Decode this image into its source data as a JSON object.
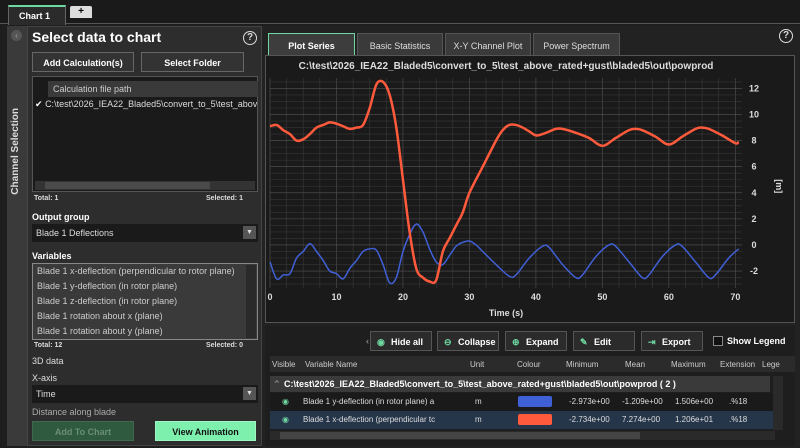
{
  "tabs": {
    "chart1": "Chart 1",
    "add": "+"
  },
  "side_label": "Channel Selection",
  "left": {
    "title": "Select data to chart",
    "add_calc": "Add Calculation(s)",
    "select_folder": "Select Folder",
    "file_header": "Calculation file path",
    "files": [
      "C:\\test\\2026_IEA22_Bladed5\\convert_to_5\\test_above"
    ],
    "files_total": "Total: 1",
    "files_selected": "Selected: 1",
    "output_group_label": "Output group",
    "output_group_value": "Blade 1 Deflections",
    "variables_label": "Variables",
    "variables": [
      "Blade 1 x-deflection (perpendicular to rotor plane)",
      "Blade 1 y-deflection (in rotor plane)",
      "Blade 1 z-deflection (in rotor plane)",
      "Blade 1 rotation about x (plane)",
      "Blade 1 rotation about y (plane)"
    ],
    "vars_total": "Total: 12",
    "vars_selected": "Selected: 0",
    "data3d": "3D data",
    "xaxis_label": "X-axis",
    "xaxis_value": "Time",
    "distance_label": "Distance along blade",
    "add_to_chart": "Add To Chart",
    "view_animation": "View Animation"
  },
  "plot_tabs": [
    "Plot Series",
    "Basic Statistics",
    "X-Y Channel Plot",
    "Power Spectrum"
  ],
  "chart_data": {
    "type": "line",
    "title": "C:\\test\\2026_IEA22_Bladed5\\convert_to_5\\test_above_rated+gust\\bladed5\\out\\powprod",
    "xlabel": "Time (s)",
    "ylabel": "[m]",
    "xlim": [
      0,
      71
    ],
    "ylim": [
      -3.3,
      12.8
    ],
    "xticks": [
      0,
      10,
      20,
      30,
      40,
      50,
      60,
      70
    ],
    "yticks": [
      -2,
      0,
      2,
      4,
      6,
      8,
      10,
      12
    ],
    "grid": true,
    "series": [
      {
        "color": "#ff5a3c",
        "x": [
          0,
          1,
          2,
          3,
          4,
          5,
          6,
          7,
          8,
          9,
          10,
          11,
          12,
          13,
          14,
          15,
          16,
          17,
          18,
          19,
          20,
          21,
          22,
          23,
          24,
          25,
          26,
          27,
          28,
          29,
          30,
          32,
          34,
          35,
          36,
          37,
          38,
          39,
          40,
          41,
          42,
          43,
          44,
          46,
          48,
          50,
          52,
          54,
          55,
          56,
          58,
          60,
          62,
          64,
          65,
          66,
          68,
          70,
          70.5
        ],
        "y": [
          9.1,
          9.2,
          8.8,
          8.5,
          8.0,
          8.1,
          8.5,
          9.0,
          9.2,
          9.4,
          9.3,
          9.1,
          8.9,
          9.0,
          9.2,
          10.5,
          12.3,
          12.5,
          11.5,
          9,
          5,
          1,
          -1.8,
          -2.5,
          -2.8,
          -2.7,
          -0.5,
          0.5,
          1.5,
          2.5,
          4,
          6,
          8,
          8.8,
          9.2,
          9.2,
          9.0,
          8.7,
          8.4,
          8.5,
          8.7,
          8.9,
          8.9,
          8.6,
          8.2,
          7.6,
          8.2,
          8.8,
          8.9,
          8.8,
          8.3,
          7.7,
          8.3,
          8.9,
          9.0,
          8.9,
          8.4,
          7.8,
          7.9
        ]
      },
      {
        "color": "#4060d8",
        "x": [
          0,
          1,
          2,
          3,
          4,
          5,
          6,
          7,
          8,
          9,
          10,
          11,
          12,
          13,
          14,
          15,
          16,
          17,
          18,
          19,
          20,
          21,
          22,
          23,
          24,
          25,
          26,
          27,
          28,
          29,
          30,
          31,
          32,
          34,
          36,
          37,
          39,
          41,
          42,
          44,
          46,
          47,
          49,
          51,
          52,
          54,
          56,
          57,
          59,
          61,
          62,
          64,
          66,
          67,
          69,
          70.5
        ],
        "y": [
          -1.3,
          -2.6,
          -2.3,
          -2.2,
          -1,
          -0.5,
          0.1,
          -0.5,
          -1.2,
          -2,
          -2.2,
          -2.6,
          -1.8,
          -1.2,
          -0.5,
          -0.3,
          -0.4,
          -1.5,
          -2.9,
          -2.5,
          -0.5,
          0.8,
          1.6,
          1.0,
          -0.3,
          -1.3,
          -1.5,
          -0.8,
          -0.1,
          0.2,
          0.3,
          0.0,
          -0.5,
          -1.5,
          -2.4,
          -2.3,
          -1.0,
          -0.1,
          -0.2,
          -1.5,
          -2.5,
          -2.3,
          -0.9,
          0,
          -0.1,
          -1.3,
          -2.5,
          -2.3,
          -0.9,
          0,
          -0.1,
          -1.3,
          -2.5,
          -2.3,
          -1.0,
          -0.3
        ]
      }
    ]
  },
  "toolbar": {
    "hide_all": "Hide all",
    "collapse": "Collapse",
    "expand": "Expand",
    "edit": "Edit",
    "export": "Export",
    "show_legend": "Show Legend"
  },
  "table": {
    "headers": [
      "Visible",
      "Variable Name",
      "Unit",
      "Colour",
      "Minimum",
      "Mean",
      "Maximum",
      "Extension",
      "Lege"
    ],
    "group": "C:\\test\\2026_IEA22_Bladed5\\convert_to_5\\test_above_rated+gust\\bladed5\\out\\powprod  ( 2 )",
    "rows": [
      {
        "name": "Blade 1 y-deflection (in rotor plane) a",
        "unit": "m",
        "color": "#4060d8",
        "min": "-2.973e+00",
        "mean": "-1.209e+00",
        "max": "1.506e+00",
        "ext": ".%18"
      },
      {
        "name": "Blade 1 x-deflection (perpendicular tc",
        "unit": "m",
        "color": "#ff5a3c",
        "min": "-2.734e+00",
        "mean": "7.274e+00",
        "max": "1.206e+01",
        "ext": ".%18"
      }
    ]
  }
}
